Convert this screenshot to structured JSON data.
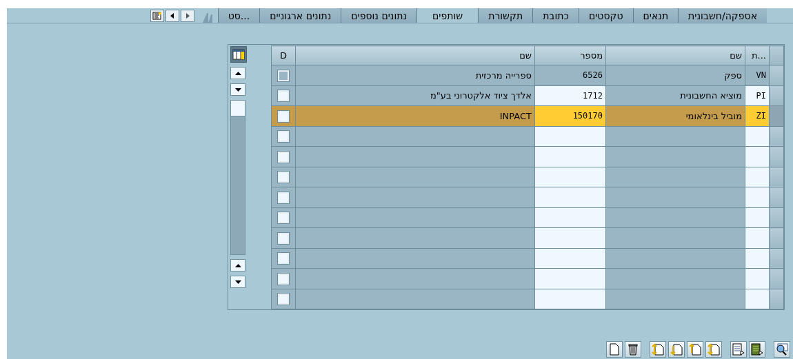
{
  "tabs": [
    {
      "label": "אספקה/חשבונית",
      "selected": false
    },
    {
      "label": "תנאים",
      "selected": false
    },
    {
      "label": "טקסטים",
      "selected": false
    },
    {
      "label": "כתובת",
      "selected": false
    },
    {
      "label": "תקשורת",
      "selected": false
    },
    {
      "label": "שותפים",
      "selected": true
    },
    {
      "label": "נתונים נוספים",
      "selected": false
    },
    {
      "label": "נתונים ארגוניים",
      "selected": false
    },
    {
      "label": "סט...",
      "selected": false
    }
  ],
  "table": {
    "columns": [
      "ת...",
      "שם",
      "מספר",
      "שם",
      "D"
    ],
    "rows": [
      {
        "code": "VN",
        "role": "ספק",
        "number": "6526",
        "name": "ספרייה מרכזית",
        "checked": false,
        "editable": false,
        "selected": false
      },
      {
        "code": "PI",
        "role": "מוציא החשבונית",
        "number": "1712",
        "name": "אלדך ציוד אלקטרוני בע\"מ",
        "checked": false,
        "editable": true,
        "selected": false
      },
      {
        "code": "ZI",
        "role": "מוביל בינלאומי",
        "number": "150170",
        "name": "INPACT",
        "checked": false,
        "editable": true,
        "selected": true
      },
      {
        "checked": false,
        "editable": true,
        "selected": false
      },
      {
        "checked": false,
        "editable": true,
        "selected": false
      },
      {
        "checked": false,
        "editable": true,
        "selected": false
      },
      {
        "checked": false,
        "editable": true,
        "selected": false
      },
      {
        "checked": false,
        "editable": true,
        "selected": false
      },
      {
        "checked": false,
        "editable": true,
        "selected": false
      },
      {
        "checked": false,
        "editable": true,
        "selected": false
      },
      {
        "checked": false,
        "editable": true,
        "selected": false
      },
      {
        "checked": false,
        "editable": true,
        "selected": false
      }
    ]
  }
}
